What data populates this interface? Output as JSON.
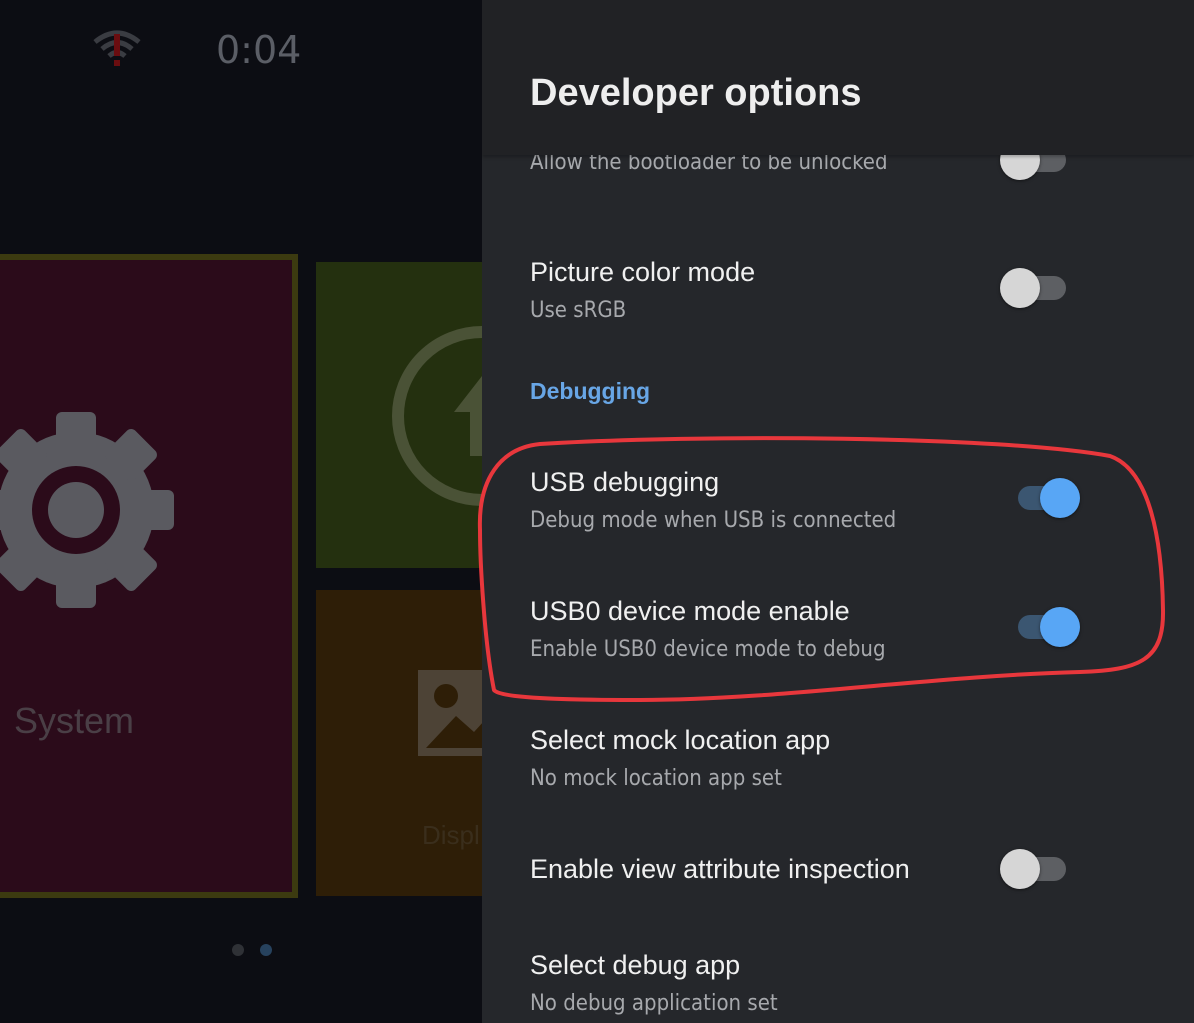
{
  "statusbar": {
    "time": "0:04",
    "wifi_icon": "wifi-alert-icon"
  },
  "launcher": {
    "tile_system_label": "System",
    "tile_display_label": "Displ",
    "page_dots": 2,
    "colors": {
      "system": "#2b0b1a",
      "update": "#24300f",
      "display": "#2e1e07"
    }
  },
  "panel": {
    "title": "Developer options",
    "items": [
      {
        "title": "",
        "subtitle": "Allow the bootloader to be unlocked",
        "toggle": false
      },
      {
        "title": "Picture color mode",
        "subtitle": "Use sRGB",
        "toggle": false
      },
      {
        "title": "USB debugging",
        "subtitle": "Debug mode when USB is connected",
        "toggle": true
      },
      {
        "title": "USB0 device mode enable",
        "subtitle": "Enable USB0 device mode to debug",
        "toggle": true
      },
      {
        "title": "Select mock location app",
        "subtitle": "No mock location app set"
      },
      {
        "title": "Enable view attribute inspection",
        "toggle": false
      },
      {
        "title": "Select debug app",
        "subtitle": "No debug application set"
      }
    ],
    "section_debugging": "Debugging",
    "accent_color": "#58a6f5"
  },
  "annotation": {
    "color": "#e8373c"
  }
}
